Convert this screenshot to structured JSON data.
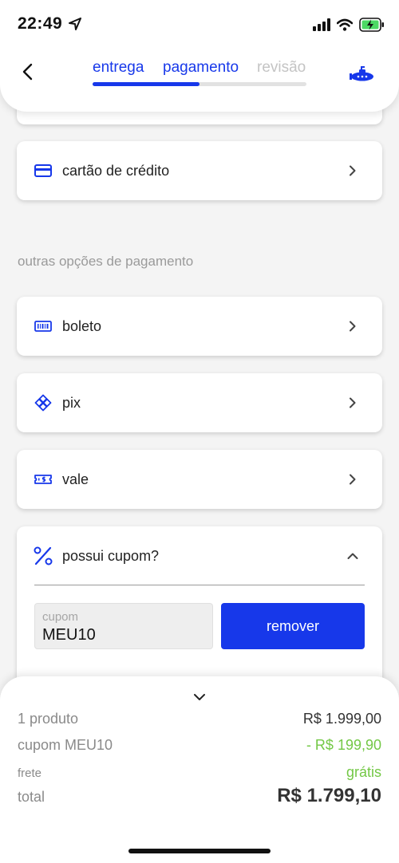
{
  "status_bar": {
    "time": "22:49"
  },
  "header": {
    "steps": [
      "entrega",
      "pagamento",
      "revisão"
    ],
    "progress_fraction": 0.5,
    "accent_color": "#1738ea",
    "logo_icon": "submarine-logo-icon"
  },
  "payment": {
    "primary_option": {
      "label": "cartão de crédito",
      "icon": "credit-card-icon"
    },
    "other_options_title": "outras opções de pagamento",
    "other_options": [
      {
        "label": "boleto",
        "icon": "barcode-icon"
      },
      {
        "label": "pix",
        "icon": "pix-icon"
      },
      {
        "label": "vale",
        "icon": "voucher-icon"
      }
    ]
  },
  "coupon": {
    "title": "possui cupom?",
    "placeholder": "cupom",
    "value": "MEU10",
    "remove_label": "remover"
  },
  "summary": {
    "items_label": "1 produto",
    "items_value": "R$ 1.999,00",
    "coupon_label": "cupom MEU10",
    "coupon_value": "- R$ 199,90",
    "shipping_label": "frete",
    "shipping_value": "grátis",
    "total_label": "total",
    "total_value": "R$ 1.799,10",
    "discount_color": "#73c845"
  }
}
